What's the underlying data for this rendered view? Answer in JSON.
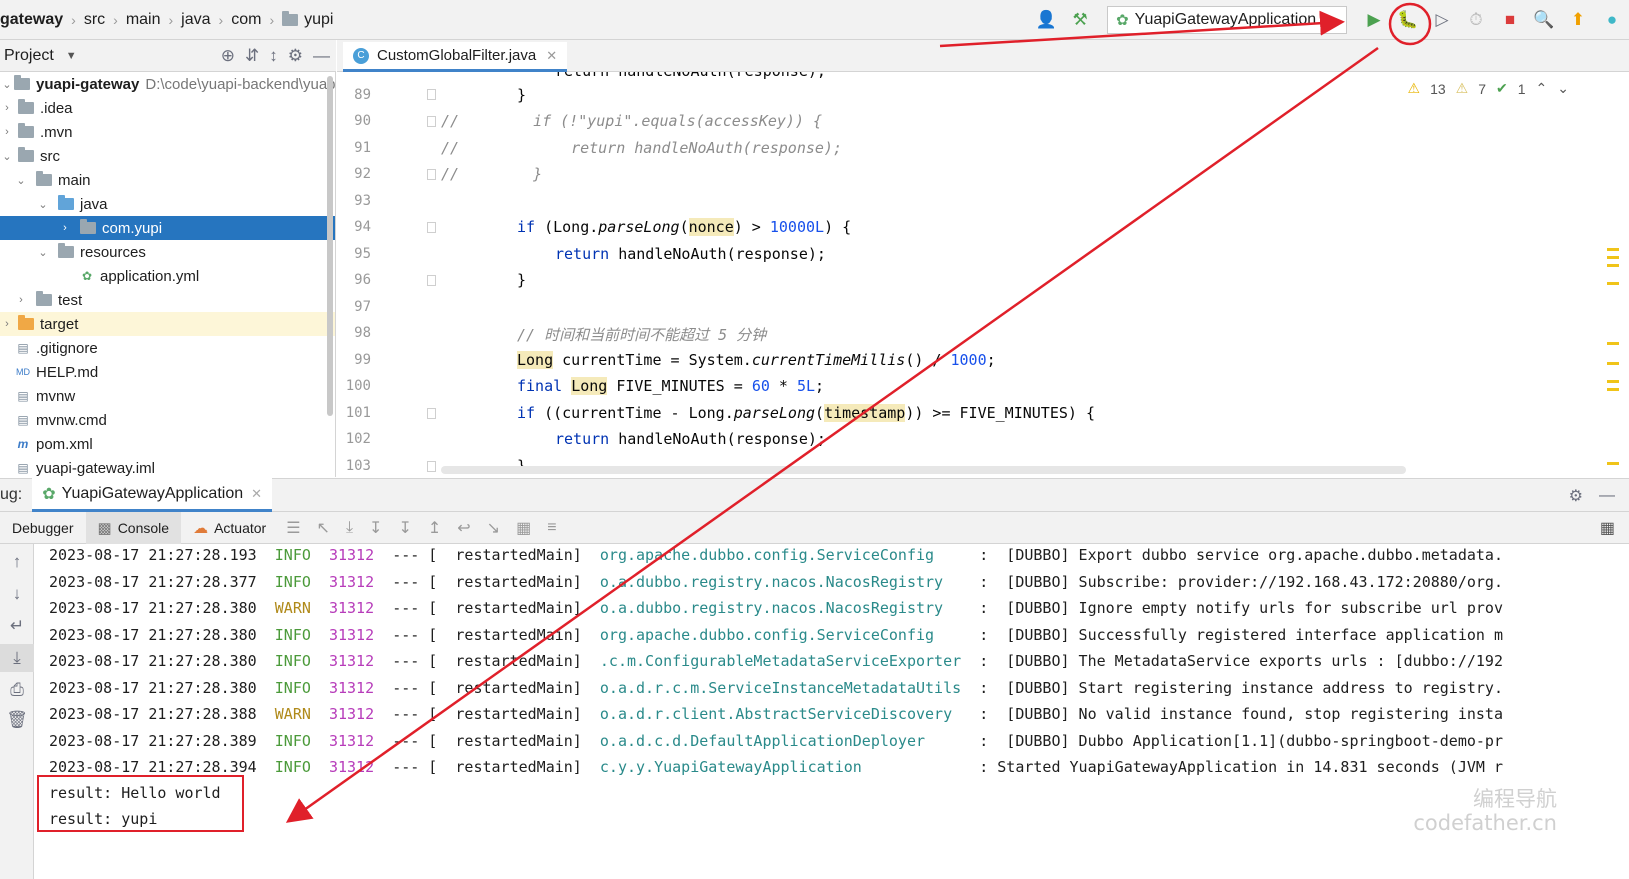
{
  "breadcrumbs": [
    "gateway",
    "src",
    "main",
    "java",
    "com",
    "yupi"
  ],
  "toolbar": {
    "run_config": "YuapiGatewayApplication"
  },
  "project_panel": {
    "title": "Project",
    "root": {
      "name": "yuapi-gateway",
      "path": "D:\\code\\yuapi-backend\\yuap"
    },
    "items": [
      {
        "label": ".idea",
        "icon": "folder-icon"
      },
      {
        "label": ".mvn",
        "icon": "folder-icon"
      },
      {
        "label": "src",
        "icon": "folder-icon"
      },
      {
        "label": "main",
        "icon": "folder-icon"
      },
      {
        "label": "java",
        "icon": "folder-icon"
      },
      {
        "label": "com.yupi",
        "icon": "package-icon"
      },
      {
        "label": "resources",
        "icon": "folder-icon"
      },
      {
        "label": "application.yml",
        "icon": "spring-config-icon"
      },
      {
        "label": "test",
        "icon": "folder-icon"
      },
      {
        "label": "target",
        "icon": "folder-icon"
      },
      {
        "label": ".gitignore",
        "icon": "file-icon"
      },
      {
        "label": "HELP.md",
        "icon": "markdown-icon"
      },
      {
        "label": "mvnw",
        "icon": "file-icon"
      },
      {
        "label": "mvnw.cmd",
        "icon": "file-icon"
      },
      {
        "label": "pom.xml",
        "icon": "maven-icon"
      },
      {
        "label": "yuapi-gateway.iml",
        "icon": "file-icon"
      }
    ]
  },
  "editor": {
    "tab": "CustomGlobalFilter.java",
    "inspections": {
      "warnings": "13",
      "weak_warnings": "7",
      "ok": "1"
    },
    "line_numbers": [
      "89",
      "90",
      "91",
      "92",
      "93",
      "94",
      "95",
      "96",
      "97",
      "98",
      "99",
      "100",
      "101",
      "102",
      "103"
    ],
    "lines": {
      "l88": "return handleNoAuth(response);",
      "l89": "}",
      "l90_slash": "//",
      "l90_code": "if (!\"yupi\".equals(accessKey)) {",
      "l91_slash": "//",
      "l91_code": "return handleNoAuth(response);",
      "l92_slash": "//",
      "l92_code": "}",
      "l94_if": "if",
      "l94_a": " (Long.",
      "l94_method": "parseLong",
      "l94_b": "(",
      "l94_var": "nonce",
      "l94_c": ") > ",
      "l94_num": "10000L",
      "l94_d": ") {",
      "l95_kw": "return",
      "l95_rest": " handleNoAuth(response);",
      "l96": "}",
      "l98": "// 时间和当前时间不能超过 5 分钟",
      "l99_type": "Long",
      "l99_a": " currentTime = System.",
      "l99_method": "currentTimeMillis",
      "l99_b": "() / ",
      "l99_num": "1000",
      "l99_c": ";",
      "l100_kw": "final",
      "l100_type": "Long",
      "l100_a": " FIVE_MINUTES = ",
      "l100_num1": "60",
      "l100_b": " * ",
      "l100_num2": "5L",
      "l100_c": ";",
      "l101_if": "if",
      "l101_a": " ((currentTime - Long.",
      "l101_method": "parseLong",
      "l101_b": "(",
      "l101_var": "timestamp",
      "l101_c": ")) >= FIVE_MINUTES) {",
      "l102_kw": "return",
      "l102_rest": " handleNoAuth(response);",
      "l103": "}"
    }
  },
  "debug": {
    "label": "ug:",
    "session_tab": "YuapiGatewayApplication",
    "tabs": [
      "Debugger",
      "Console",
      "Actuator"
    ],
    "logs": [
      {
        "ts": "2023-08-17 21:27:28.193",
        "lvl": "INFO",
        "pid": "31312",
        "thread": "--- [  restartedMain]",
        "cls": "org.apache.dubbo.config.ServiceConfig    ",
        "msg": " :  [DUBBO] Export dubbo service org.apache.dubbo.metadata."
      },
      {
        "ts": "2023-08-17 21:27:28.377",
        "lvl": "INFO",
        "pid": "31312",
        "thread": "--- [  restartedMain]",
        "cls": "o.a.dubbo.registry.nacos.NacosRegistry   ",
        "msg": " :  [DUBBO] Subscribe: provider://192.168.43.172:20880/org."
      },
      {
        "ts": "2023-08-17 21:27:28.380",
        "lvl": "WARN",
        "pid": "31312",
        "thread": "--- [  restartedMain]",
        "cls": "o.a.dubbo.registry.nacos.NacosRegistry   ",
        "msg": " :  [DUBBO] Ignore empty notify urls for subscribe url prov"
      },
      {
        "ts": "2023-08-17 21:27:28.380",
        "lvl": "INFO",
        "pid": "31312",
        "thread": "--- [  restartedMain]",
        "cls": "org.apache.dubbo.config.ServiceConfig    ",
        "msg": " :  [DUBBO] Successfully registered interface application m"
      },
      {
        "ts": "2023-08-17 21:27:28.380",
        "lvl": "INFO",
        "pid": "31312",
        "thread": "--- [  restartedMain]",
        "cls": ".c.m.ConfigurableMetadataServiceExporter ",
        "msg": " :  [DUBBO] The MetadataService exports urls : [dubbo://192"
      },
      {
        "ts": "2023-08-17 21:27:28.380",
        "lvl": "INFO",
        "pid": "31312",
        "thread": "--- [  restartedMain]",
        "cls": "o.a.d.r.c.m.ServiceInstanceMetadataUtils ",
        "msg": " :  [DUBBO] Start registering instance address to registry."
      },
      {
        "ts": "2023-08-17 21:27:28.388",
        "lvl": "WARN",
        "pid": "31312",
        "thread": "--- [  restartedMain]",
        "cls": "o.a.d.r.client.AbstractServiceDiscovery  ",
        "msg": " :  [DUBBO] No valid instance found, stop registering insta"
      },
      {
        "ts": "2023-08-17 21:27:28.389",
        "lvl": "INFO",
        "pid": "31312",
        "thread": "--- [  restartedMain]",
        "cls": "o.a.d.c.d.DefaultApplicationDeployer     ",
        "msg": " :  [DUBBO] Dubbo Application[1.1](dubbo-springboot-demo-pr"
      },
      {
        "ts": "2023-08-17 21:27:28.394",
        "lvl": "INFO",
        "pid": "31312",
        "thread": "--- [  restartedMain]",
        "cls": "c.y.y.YuapiGatewayApplication            ",
        "msg": " : Started YuapiGatewayApplication in 14.831 seconds (JVM r"
      }
    ],
    "results": [
      "result: Hello world",
      "result: yupi"
    ]
  },
  "watermark": {
    "line1": "编程导航",
    "line2": "codefather.cn"
  },
  "colors": {
    "accent": "#2675bf",
    "annotation": "#e0202a"
  }
}
